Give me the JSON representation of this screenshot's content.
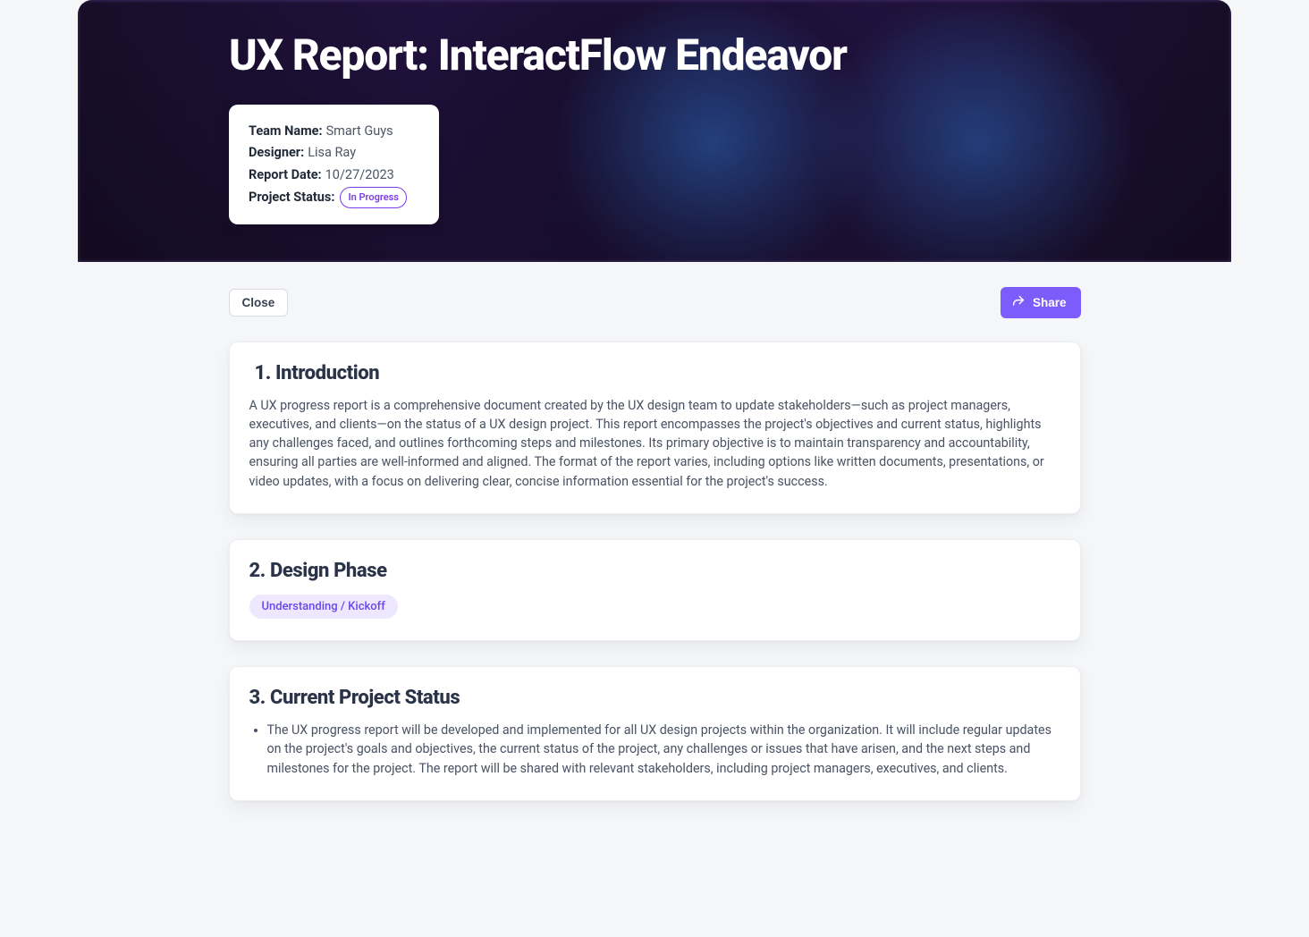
{
  "header": {
    "title": "UX Report: InteractFlow Endeavor",
    "meta": {
      "team_label": "Team Name:",
      "team_value": "Smart Guys",
      "designer_label": "Designer:",
      "designer_value": "Lisa Ray",
      "date_label": "Report Date:",
      "date_value": "10/27/2023",
      "status_label": "Project Status:",
      "status_value": "In Progress"
    }
  },
  "actions": {
    "close_label": "Close",
    "share_label": "Share"
  },
  "sections": {
    "intro": {
      "heading": "1. Introduction",
      "body": "A UX progress report is a comprehensive document created by the UX design team to update stakeholders—such as project managers, executives, and clients—on the status of a UX design project. This report encompasses the project's objectives and current status, highlights any challenges faced, and outlines forthcoming steps and milestones. Its primary objective is to maintain transparency and accountability, ensuring all parties are well-informed and aligned. The format of the report varies, including options like written documents, presentations, or video updates, with a focus on delivering clear, concise information essential for the project's success."
    },
    "design_phase": {
      "heading": "2. Design Phase",
      "tag": "Understanding / Kickoff"
    },
    "status": {
      "heading": "3. Current Project Status",
      "bullet1": "The UX progress report will be developed and implemented for all UX design projects within the organization. It will include regular updates on the project's goals and objectives, the current status of the project, any challenges or issues that have arisen, and the next steps and milestones for the project. The report will be shared with relevant stakeholders, including project managers, executives, and clients."
    }
  }
}
